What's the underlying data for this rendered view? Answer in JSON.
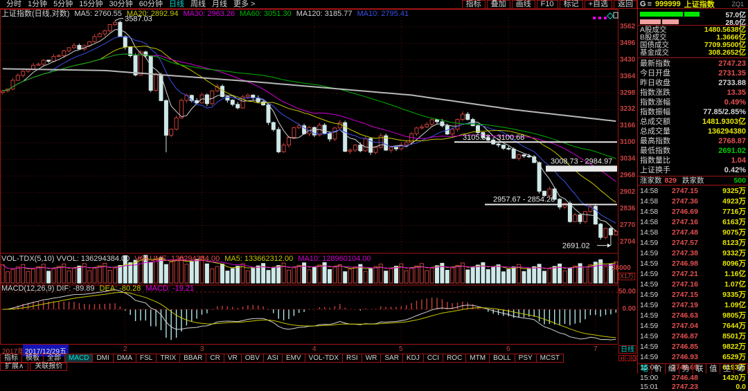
{
  "toolbar": {
    "timeframes": [
      "分时",
      "1分钟",
      "5分钟",
      "15分钟",
      "30分钟",
      "60分钟",
      "日线",
      "周线",
      "月线",
      "更多 >"
    ],
    "active_timeframe": "日线",
    "right_buttons": [
      "指标",
      "叠加",
      "画线",
      "F10",
      "标记",
      "+自选",
      "返回"
    ]
  },
  "symbol": {
    "prefix": "G",
    "menu_icon": "≡",
    "code": "999999",
    "name": "上证指数",
    "tag": "ZQ1"
  },
  "chart": {
    "title": "上证指数(日线,对数)",
    "ma_labels": [
      {
        "text": "MA5: 2760.55",
        "color": "#d4d4d4"
      },
      {
        "text": "MA20: 2892.94",
        "color": "#c8c800"
      },
      {
        "text": "MA30: 2963.26",
        "color": "#d200d2"
      },
      {
        "text": "MA60: 3051.30",
        "color": "#00b400"
      },
      {
        "text": "MA120: 3185.77",
        "color": "#d4d4d4"
      },
      {
        "text": "MA10: 2795.41",
        "color": "#3c50e6"
      }
    ],
    "vol_labels": [
      {
        "text": "VOL-TDX(5,10) VVOL: 136294384.00",
        "color": "#d4d4d4"
      },
      {
        "text": "VOLUME: 136294384.00",
        "color": "#e65050"
      },
      {
        "text": "MA5: 133662312.00",
        "color": "#c8c800"
      },
      {
        "text": "MA10: 128960104.00",
        "color": "#d200d2"
      }
    ],
    "macd_labels": [
      {
        "text": "MACD(12,26,9) DIF: -89.89",
        "color": "#d4d4d4"
      },
      {
        "text": "DEA: -80.28",
        "color": "#c8c800"
      },
      {
        "text": "MACD: -19.21",
        "color": "#e600e6"
      }
    ],
    "axis_extra": {
      "vol_top": "38000",
      "vol_unit": "X1万",
      "macd_50": "50.00",
      "macd_0": "0.00",
      "period": "日线",
      "zoom_buttons": [
        "+",
        "-",
        "0"
      ]
    },
    "x_axis": {
      "year": "2017年",
      "date": "2017/12/29五"
    }
  },
  "chart_data": {
    "type": "candlestick",
    "symbol": "上证指数",
    "period": "daily-log",
    "price_axis": [
      3562,
      3496,
      3430,
      3364,
      3298,
      3232,
      3166,
      3100,
      3034,
      2968,
      2902,
      2836,
      2770,
      2704
    ],
    "ylim": [
      2668,
      3600
    ],
    "closes": [
      3307,
      3314,
      3349,
      3369,
      3385,
      3392,
      3409,
      3413,
      3429,
      3425,
      3444,
      3447,
      3466,
      3479,
      3488,
      3474,
      3487,
      3503,
      3523,
      3534,
      3546,
      3571,
      3580,
      3523,
      3481,
      3447,
      3370,
      3462,
      3446,
      3309,
      3371,
      3268,
      3130,
      3154,
      3199,
      3269,
      3289,
      3268,
      3259,
      3291,
      3256,
      3307,
      3325,
      3284,
      3270,
      3253,
      3239,
      3283,
      3290,
      3279,
      3263,
      3251,
      3181,
      3153,
      3064,
      3091,
      3122,
      3160,
      3168,
      3136,
      3161,
      3131,
      3170,
      3138,
      3115,
      3159,
      3180,
      3066,
      3071,
      3091,
      3068,
      3117,
      3062,
      3082,
      3128,
      3071,
      3082,
      3076,
      3091,
      3101,
      3136,
      3159,
      3163,
      3174,
      3192,
      3184,
      3168,
      3135,
      3154,
      3193,
      3214,
      3193,
      3168,
      3141,
      3120,
      3111,
      3095,
      3091,
      3078,
      3075,
      3038,
      3052,
      3047,
      3044,
      3021,
      2907,
      2890,
      2916,
      2875,
      2844,
      2859,
      2786,
      2813,
      2786,
      2826,
      2847,
      2776,
      2723,
      2759,
      2733,
      2747
    ],
    "overrides": {
      "22": {
        "high": 3587.03
      },
      "32": {
        "low": 3062
      },
      "119": {
        "low": 2691.02
      }
    },
    "ma120_anchors": [
      [
        0,
        3395
      ],
      [
        20,
        3388
      ],
      [
        50,
        3342
      ],
      [
        80,
        3290
      ],
      [
        100,
        3232
      ],
      [
        120,
        3186
      ]
    ],
    "month_ticks": [
      {
        "label": "2",
        "index": 24
      },
      {
        "label": "3",
        "index": 39
      },
      {
        "label": "4",
        "index": 61
      },
      {
        "label": "5",
        "index": 78
      },
      {
        "label": "6",
        "index": 99
      },
      {
        "label": "7",
        "index": 116
      }
    ],
    "annotations": {
      "peak": "3587.03",
      "gap1": {
        "text": "3105.58 - 3100.68",
        "x": 656,
        "price": 3103
      },
      "gap2": {
        "text": "3008.73 - 2984.97",
        "x": 788,
        "price_top": 3008.73,
        "price_bot": 2984.97
      },
      "gap3": {
        "text": "2957.67 - 2854.26",
        "x": 700,
        "price": 2854.26
      },
      "low": "2691.02",
      "peak_index": 22,
      "low_index": 119
    }
  },
  "indicator_tabs": [
    "指标",
    "模板",
    "全部",
    "MACD",
    "DMI",
    "DMA",
    "FSL",
    "TRIX",
    "BBAR",
    "CR",
    "VR",
    "OBV",
    "ASI",
    "EMV",
    "VOL-TDX",
    "RSI",
    "WR",
    "SAR",
    "KDJ",
    "CCI",
    "ROC",
    "MTM",
    "BOLL",
    "PSY",
    "MCST"
  ],
  "active_indicator": "MACD",
  "bottom_left": [
    "扩展∧",
    "关联报价"
  ],
  "right_panel": {
    "bars": [
      {
        "value": "57.0亿",
        "color": "#00e600",
        "seg1": 62,
        "seg2": 22
      },
      {
        "value": "28.0亿",
        "color": "#f0a0a0",
        "seg1": 30,
        "seg2": 24
      }
    ],
    "turnover": [
      {
        "label": "A股成交",
        "value": "1480.5638亿"
      },
      {
        "label": "B股成交",
        "value": "1.3666亿"
      },
      {
        "label": "国债成交",
        "value": "7709.9500亿"
      },
      {
        "label": "基金成交",
        "value": "308.2652亿"
      }
    ],
    "quotes": [
      {
        "label": "最新指数",
        "value": "2747.23",
        "color": "c-red"
      },
      {
        "label": "今日开盘",
        "value": "2731.35",
        "color": "c-red"
      },
      {
        "label": "昨日收盘",
        "value": "2733.88",
        "color": "c-white"
      },
      {
        "label": "指数涨跌",
        "value": "13.35",
        "color": "c-red"
      },
      {
        "label": "指数涨幅",
        "value": "0.49%",
        "color": "c-red"
      },
      {
        "label": "指数振幅",
        "value": "77.85/2.85%",
        "color": "c-white"
      },
      {
        "label": "总成交额",
        "value": "1481.9303亿",
        "color": "c-yellow"
      },
      {
        "label": "总成交量",
        "value": "136294380",
        "color": "c-yellow"
      },
      {
        "label": "最高指数",
        "value": "2768.87",
        "color": "c-red"
      },
      {
        "label": "最低指数",
        "value": "2691.02",
        "color": "c-green"
      },
      {
        "label": "指数量比",
        "value": "1.04",
        "color": "c-red"
      },
      {
        "label": "上证换手",
        "value": "0.42%",
        "color": "c-white"
      }
    ],
    "updown": {
      "up_label": "涨家数",
      "up_value": "829",
      "down_label": "跌家数",
      "down_value": "500"
    },
    "ticks": [
      [
        "14:58",
        "2747.15",
        "9325万"
      ],
      [
        "14:58",
        "2747.36",
        "4923万"
      ],
      [
        "14:58",
        "2746.69",
        "7716万"
      ],
      [
        "14:58",
        "2747.16",
        "6163万"
      ],
      [
        "14:58",
        "2747.48",
        "9075万"
      ],
      [
        "14:59",
        "2747.57",
        "8123万"
      ],
      [
        "14:59",
        "2747.38",
        "9332万"
      ],
      [
        "14:59",
        "2746.98",
        "8096万"
      ],
      [
        "14:59",
        "2747.21",
        "1.16亿"
      ],
      [
        "14:59",
        "2747.16",
        "1.07亿"
      ],
      [
        "14:59",
        "2747.15",
        "9335万"
      ],
      [
        "14:59",
        "2747.19",
        "1.09亿"
      ],
      [
        "14:59",
        "2746.63",
        "9805万"
      ],
      [
        "14:59",
        "2747.04",
        "7644万"
      ],
      [
        "14:59",
        "2746.87",
        "8501万"
      ],
      [
        "14:59",
        "2746.85",
        "9822万"
      ],
      [
        "14:59",
        "2746.93",
        "6529万"
      ],
      [
        "15:00",
        "2746.69",
        "6193万"
      ],
      [
        "15:00",
        "2746.48",
        "1420万"
      ],
      [
        "15:01",
        "2747.23",
        "0.0"
      ]
    ],
    "tabs": [
      "笔",
      "价",
      "细",
      "势",
      "联",
      "值",
      "主",
      "筹"
    ],
    "active_tab": "笔"
  }
}
